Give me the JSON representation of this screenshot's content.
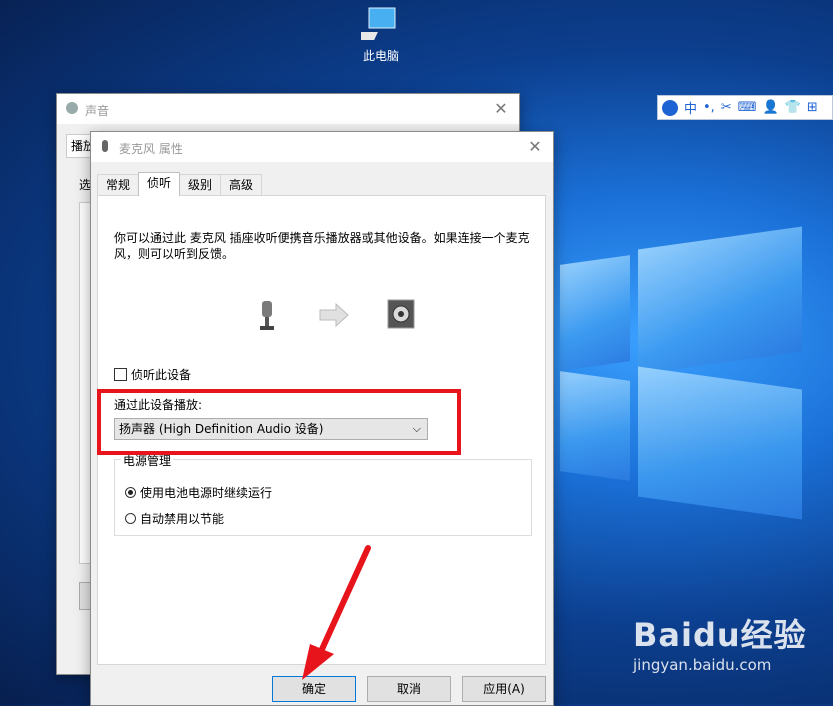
{
  "desktop": {
    "icon_label": "此电脑"
  },
  "ime": {
    "items": [
      "中",
      "•,",
      "✂",
      "⌨",
      "👤",
      "👕",
      "⊞"
    ]
  },
  "sound_window": {
    "title": "声音",
    "tab_partial": "播放",
    "label_partial": "选"
  },
  "dialog": {
    "title": "麦克风 属性",
    "tabs": [
      "常规",
      "侦听",
      "级别",
      "高级"
    ],
    "active_tab": 1,
    "description": "你可以通过此 麦克风 插座收听便携音乐播放器或其他设备。如果连接一个麦克风，则可以听到反馈。",
    "listen_checkbox": "侦听此设备",
    "listen_checked": false,
    "playback_label": "通过此设备播放:",
    "playback_value": "扬声器 (High Definition Audio 设备)",
    "power_group": "电源管理",
    "radio_options": [
      "使用电池电源时继续运行",
      "自动禁用以节能"
    ],
    "radio_selected": 0,
    "buttons": {
      "ok": "确定",
      "cancel": "取消",
      "apply": "应用(A)"
    }
  },
  "watermark": {
    "brand": "Baidu经验",
    "url": "jingyan.baidu.com"
  },
  "colors": {
    "highlight": "#e8141b",
    "accent": "#0078d7"
  }
}
